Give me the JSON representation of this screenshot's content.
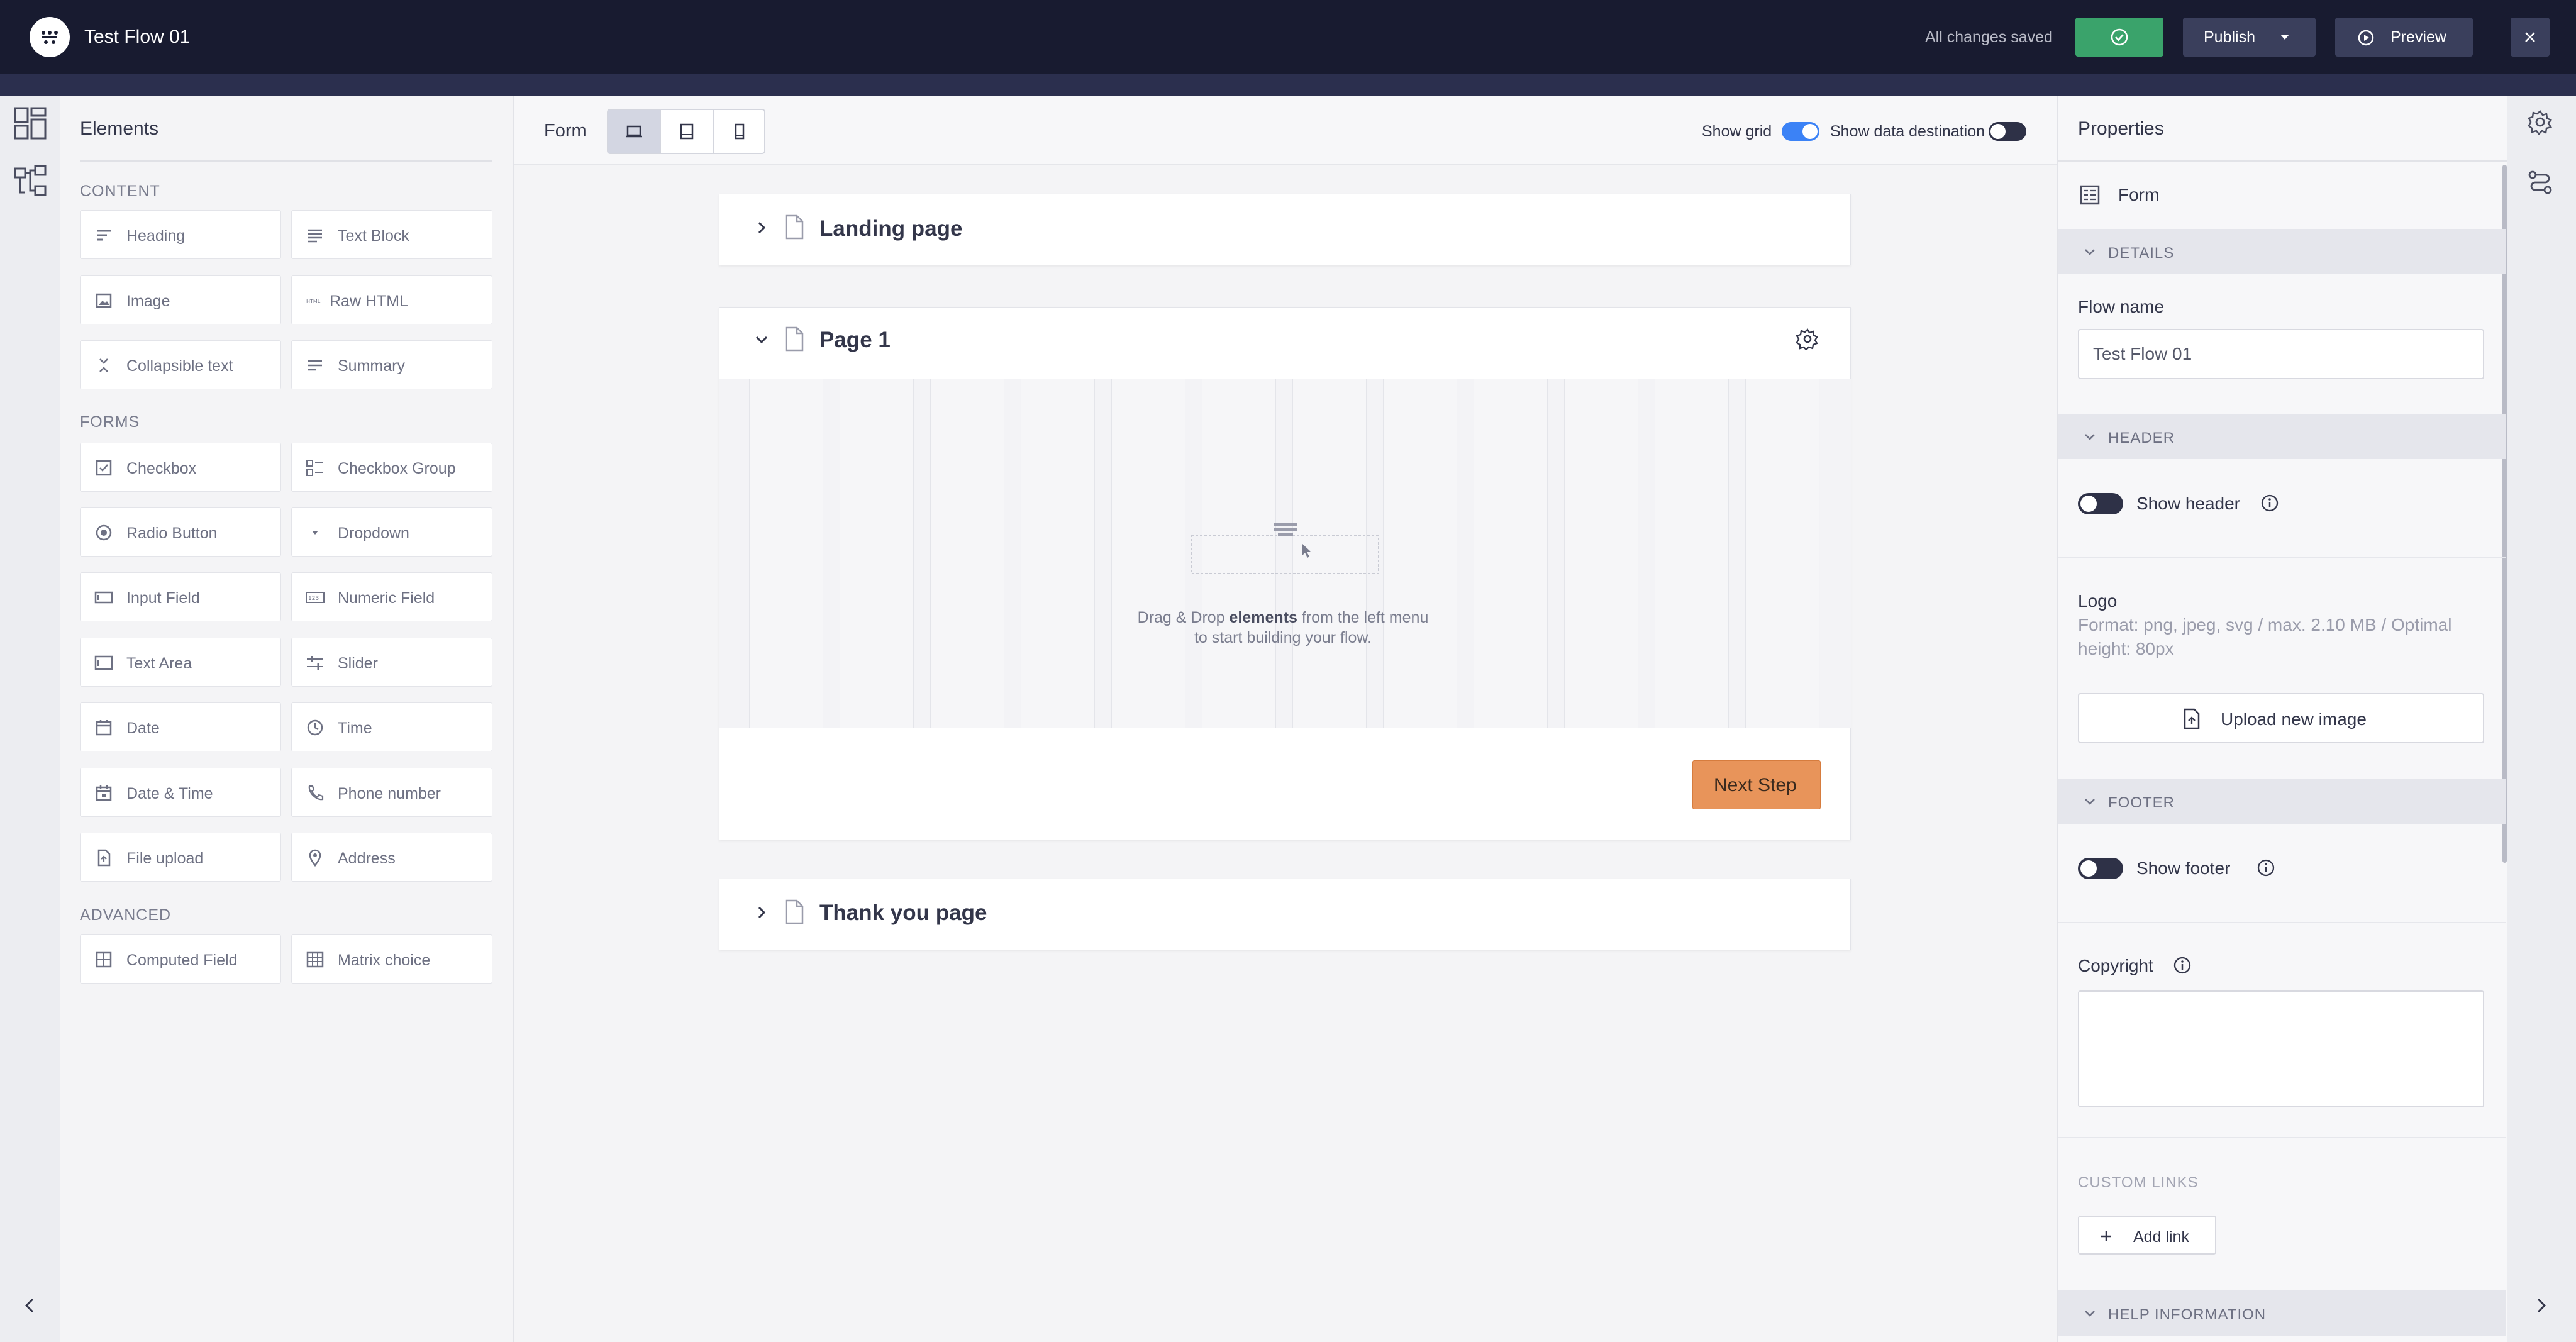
{
  "app": {
    "title": "Test Flow 01",
    "status": "All changes saved"
  },
  "topbar": {
    "publish_label": "Publish",
    "preview_label": "Preview"
  },
  "icons": {
    "logo": "flow-logo-icon",
    "save": "check-circle-icon",
    "publish_caret": "caret-down-icon",
    "preview": "play-circle-icon",
    "close": "close-icon",
    "elements": "layout-grid-icon",
    "structure": "tree-icon",
    "collapse": "chevron-left-icon",
    "expand": "chevron-right-icon",
    "settings": "gear-icon",
    "connections": "route-icon"
  },
  "elements_panel": {
    "title": "Elements",
    "sections": [
      {
        "label": "CONTENT",
        "items": [
          {
            "label": "Heading",
            "icon": "heading-icon"
          },
          {
            "label": "Text Block",
            "icon": "text-block-icon"
          },
          {
            "label": "Image",
            "icon": "image-icon"
          },
          {
            "label": "Raw HTML",
            "icon": "html-icon"
          },
          {
            "label": "Collapsible text",
            "icon": "collapse-icon"
          },
          {
            "label": "Summary",
            "icon": "summary-icon"
          }
        ]
      },
      {
        "label": "FORMS",
        "items": [
          {
            "label": "Checkbox",
            "icon": "checkbox-icon"
          },
          {
            "label": "Checkbox Group",
            "icon": "checkbox-group-icon"
          },
          {
            "label": "Radio Button",
            "icon": "radio-icon"
          },
          {
            "label": "Dropdown",
            "icon": "dropdown-icon"
          },
          {
            "label": "Input Field",
            "icon": "input-field-icon"
          },
          {
            "label": "Numeric Field",
            "icon": "numeric-field-icon"
          },
          {
            "label": "Text Area",
            "icon": "text-area-icon"
          },
          {
            "label": "Slider",
            "icon": "slider-icon"
          },
          {
            "label": "Date",
            "icon": "calendar-icon"
          },
          {
            "label": "Time",
            "icon": "clock-icon"
          },
          {
            "label": "Date & Time",
            "icon": "calendar-clock-icon"
          },
          {
            "label": "Phone number",
            "icon": "phone-icon"
          },
          {
            "label": "File upload",
            "icon": "file-upload-icon"
          },
          {
            "label": "Address",
            "icon": "map-pin-icon"
          }
        ]
      },
      {
        "label": "ADVANCED",
        "items": [
          {
            "label": "Computed Field",
            "icon": "calculator-icon"
          },
          {
            "label": "Matrix choice",
            "icon": "table-icon"
          }
        ]
      }
    ]
  },
  "canvas": {
    "form_label": "Form",
    "devices": [
      "desktop-icon",
      "tablet-icon",
      "mobile-icon"
    ],
    "active_device": "desktop",
    "show_grid_label": "Show grid",
    "show_grid_on": true,
    "show_data_destination_label": "Show data destination",
    "show_data_destination_on": false,
    "pages": [
      {
        "title": "Landing page",
        "expanded": false
      },
      {
        "title": "Page 1",
        "expanded": true
      },
      {
        "title": "Thank you page",
        "expanded": false
      }
    ],
    "drop_hint_pre": "Drag & Drop ",
    "drop_hint_bold": "elements",
    "drop_hint_post": " from the left menu to start building your flow.",
    "next_step_label": "Next Step",
    "accent": "#3b82f6"
  },
  "properties": {
    "title": "Properties",
    "form_label": "Form",
    "details_section": "DETAILS",
    "flow_name_label": "Flow name",
    "flow_name_value": "Test Flow 01",
    "header_section": "HEADER",
    "show_header_label": "Show header",
    "show_header_on": false,
    "logo_label": "Logo",
    "logo_hint": "Format: png, jpeg, svg / max. 2.10 MB / Optimal height: 80px",
    "upload_label": "Upload new image",
    "footer_section": "FOOTER",
    "show_footer_label": "Show footer",
    "show_footer_on": false,
    "copyright_label": "Copyright",
    "copyright_value": "",
    "custom_links_label": "CUSTOM LINKS",
    "add_link_label": "Add link",
    "help_section": "HELP INFORMATION"
  }
}
